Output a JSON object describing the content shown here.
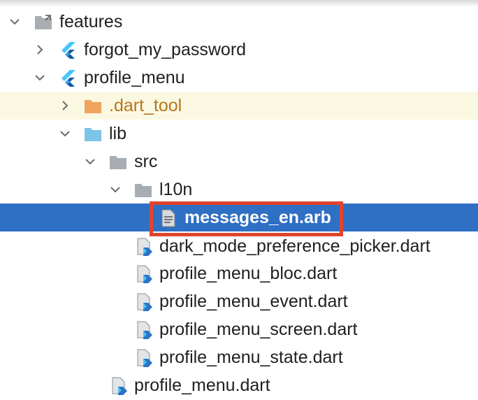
{
  "tree": {
    "rows": [
      {
        "label": "features",
        "icon": "folder-link-icon",
        "arrow": "expanded"
      },
      {
        "label": "forgot_my_password",
        "icon": "flutter-icon",
        "arrow": "collapsed"
      },
      {
        "label": "profile_menu",
        "icon": "flutter-icon",
        "arrow": "expanded"
      },
      {
        "label": ".dart_tool",
        "icon": "orange-folder-icon",
        "arrow": "collapsed"
      },
      {
        "label": "lib",
        "icon": "blue-folder-icon",
        "arrow": "expanded"
      },
      {
        "label": "src",
        "icon": "folder-icon",
        "arrow": "expanded"
      },
      {
        "label": "l10n",
        "icon": "folder-icon",
        "arrow": "expanded"
      },
      {
        "label": "messages_en.arb",
        "icon": "text-file-icon",
        "selected": true
      },
      {
        "label": "dark_mode_preference_picker.dart",
        "icon": "dart-file-icon"
      },
      {
        "label": "profile_menu_bloc.dart",
        "icon": "dart-file-icon"
      },
      {
        "label": "profile_menu_event.dart",
        "icon": "dart-file-icon"
      },
      {
        "label": "profile_menu_screen.dart",
        "icon": "dart-file-icon"
      },
      {
        "label": "profile_menu_state.dart",
        "icon": "dart-file-icon"
      },
      {
        "label": "profile_menu.dart",
        "icon": "dart-file-icon"
      }
    ]
  },
  "colors": {
    "selection": "#2f6fc4",
    "highlight_border": "#e0442c",
    "excluded_folder_text": "#b8761a",
    "excluded_row_bg": "#fbf8e2"
  }
}
